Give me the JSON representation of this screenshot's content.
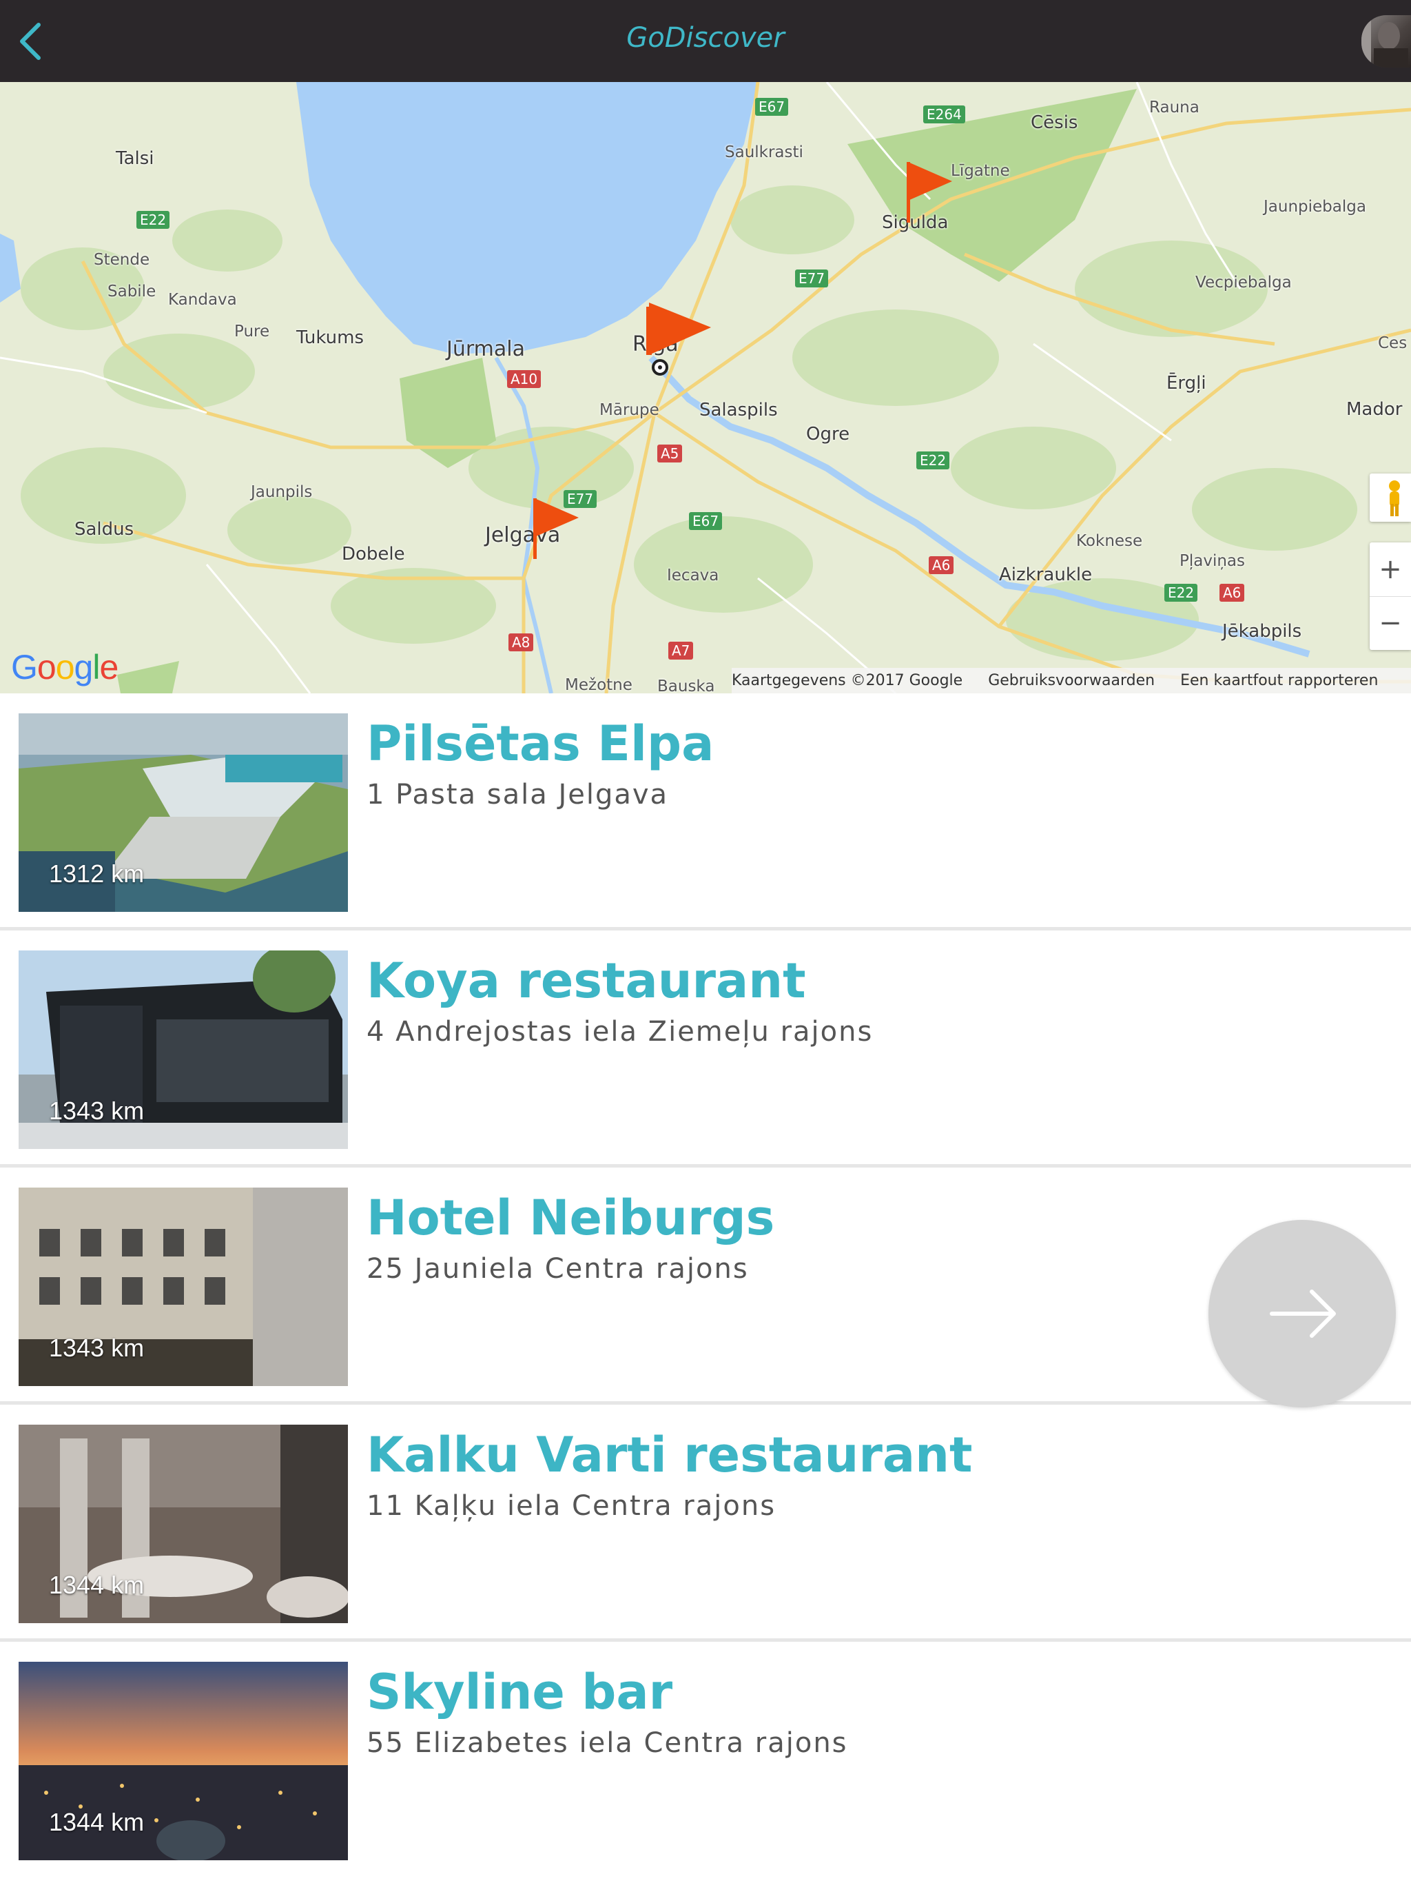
{
  "header": {
    "title": "GoDiscover",
    "back_icon": "chevron-left-icon",
    "accent_color": "#3fb8c8",
    "background_color": "#2b272a"
  },
  "map": {
    "labels": {
      "talsi": "Talsi",
      "stende": "Stende",
      "sabile": "Sabile",
      "kandava": "Kandava",
      "pure": "Pure",
      "tukums": "Tukums",
      "jurmala": "Jūrmala",
      "riga": "Rīga",
      "marupe": "Mārupe",
      "salaspils": "Salaspils",
      "ogre": "Ogre",
      "saulkrasti": "Saulkrasti",
      "sigulda": "Sigulda",
      "ligatne": "Līgatne",
      "cesis": "Cēsis",
      "rauna": "Rauna",
      "jaunpiebalga": "Jaunpiebalga",
      "vecpiebalga": "Vecpiebalga",
      "ergli": "Ērgļi",
      "madona": "Mador",
      "cesvaine": "Ces",
      "jaunpils": "Jaunpils",
      "saldus": "Saldus",
      "dobele": "Dobele",
      "jelgava": "Jelgava",
      "iecava": "Iecava",
      "koknese": "Koknese",
      "aizkraukle": "Aizkraukle",
      "plavinas": "Pļaviņas",
      "jekabpils": "Jēkabpils",
      "mezotne": "Mežotne",
      "bauska": "Bauska"
    },
    "roads": {
      "e22_west": "E22",
      "a10": "A10",
      "e67_north": "E67",
      "e264": "E264",
      "e77_east": "E77",
      "a5": "A5",
      "e77_south": "E77",
      "e67_south": "E67",
      "e22_east": "E22",
      "a6_west": "A6",
      "a6_east": "A6",
      "e22_far": "E22",
      "a8": "A8",
      "a7": "A7"
    },
    "google_logo": "Google",
    "attribution": {
      "copyright": "Kaartgegevens ©2017 Google",
      "terms": "Gebruiksvoorwaarden",
      "report": "Een kaartfout rapporteren"
    },
    "zoom_in": "+",
    "zoom_out": "−",
    "flag_color": "#ee4e0f"
  },
  "places": [
    {
      "title": "Pilsētas Elpa",
      "address": "1 Pasta sala Jelgava",
      "distance": "1312 km"
    },
    {
      "title": "Koya restaurant",
      "address": "4 Andrejostas iela Ziemeļu rajons",
      "distance": "1343 km"
    },
    {
      "title": "Hotel Neiburgs",
      "address": "25 Jauniela Centra rajons",
      "distance": "1343 km"
    },
    {
      "title": "Kalku Varti restaurant",
      "address": "11 Kaļķu iela Centra rajons",
      "distance": "1344 km"
    },
    {
      "title": "Skyline bar",
      "address": "55 Elizabetes iela Centra rajons",
      "distance": "1344 km"
    }
  ],
  "fab": {
    "icon": "arrow-right-icon"
  }
}
